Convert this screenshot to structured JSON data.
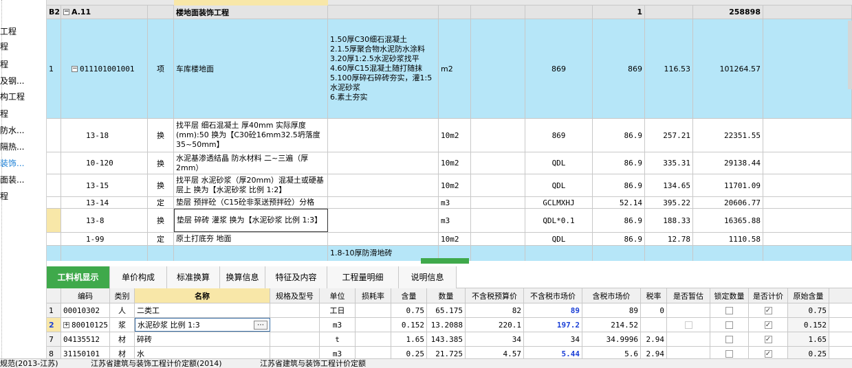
{
  "sidebar": {
    "items": [
      {
        "label": "工程"
      },
      {
        "label": "程"
      },
      {
        "label": "程"
      },
      {
        "label": "及钢..."
      },
      {
        "label": "构工程"
      },
      {
        "label": "程"
      },
      {
        "label": "防水..."
      },
      {
        "label": "隔热..."
      },
      {
        "label": "装饰..."
      },
      {
        "label": "面装..."
      },
      {
        "label": "程"
      }
    ],
    "selected_index": 8
  },
  "grid": {
    "section_row": {
      "num": "B2",
      "code": "A.11",
      "name": "楼地面装饰工程",
      "quantity": "1",
      "total": "258898"
    },
    "main_item": {
      "num": "1",
      "code": "011101001001",
      "type": "项",
      "name": "车库楼地面",
      "features": "1.50厚C30细石混凝土\n2.1.5厚聚合物水泥防水涂料\n3.20厚1:2.5水泥砂浆找平\n4.60厚C15混凝土随打随抹\n5.100厚碎石碎砖夯实，灌1:5水泥砂浆\n6.素土夯实",
      "unit": "m2",
      "qty_expr": "869",
      "quantity": "869",
      "unit_price": "116.53",
      "total": "101264.57"
    },
    "sub_items": [
      {
        "code": "13-18",
        "type": "换",
        "name": "找平层 细石混凝土 厚40mm  实际厚度(mm):50  换为【C30砼16mm32.5坍落度35~50mm】",
        "unit": "10m2",
        "qty_expr": "869",
        "quantity": "86.9",
        "unit_price": "257.21",
        "total": "22351.55"
      },
      {
        "code": "10-120",
        "type": "换",
        "name": "水泥基渗透结晶 防水材料 二~三遍（厚2mm）",
        "unit": "10m2",
        "qty_expr": "QDL",
        "quantity": "86.9",
        "unit_price": "335.31",
        "total": "29138.44"
      },
      {
        "code": "13-15",
        "type": "换",
        "name": "找平层 水泥砂浆（厚20mm）混凝土或硬基层上  换为【水泥砂浆 比例 1:2】",
        "unit": "10m2",
        "qty_expr": "QDL",
        "quantity": "86.9",
        "unit_price": "134.65",
        "total": "11701.09"
      },
      {
        "code": "13-14",
        "type": "定",
        "name": "垫层 预拌砼（C15砼非泵送预拌砼）分格",
        "unit": "m3",
        "qty_expr": "GCLMXHJ",
        "quantity": "52.14",
        "unit_price": "395.22",
        "total": "20606.77"
      },
      {
        "code": "13-8",
        "type": "换",
        "name": "垫层 碎砖 灌浆  换为【水泥砂浆 比例 1:3】",
        "unit": "m3",
        "qty_expr": "QDL*0.1",
        "quantity": "86.9",
        "unit_price": "188.33",
        "total": "16365.88"
      },
      {
        "code": "1-99",
        "type": "定",
        "name": "原土打底夯 地面",
        "unit": "10m2",
        "qty_expr": "QDL",
        "quantity": "86.9",
        "unit_price": "12.78",
        "total": "1110.58"
      }
    ],
    "partial_row_features": "1.8-10厚防滑地砖"
  },
  "tabs": [
    {
      "label": "工料机显示",
      "active": true
    },
    {
      "label": "单价构成"
    },
    {
      "label": "标准换算"
    },
    {
      "label": "换算信息"
    },
    {
      "label": "特征及内容"
    },
    {
      "label": "工程量明细"
    },
    {
      "label": "说明信息"
    }
  ],
  "bottom_grid": {
    "headers": [
      "编码",
      "类别",
      "名称",
      "规格及型号",
      "单位",
      "损耗率",
      "含量",
      "数量",
      "不含税预算价",
      "不含税市场价",
      "含税市场价",
      "税率",
      "是否暂估",
      "锁定数量",
      "是否计价",
      "原始含量"
    ],
    "rows": [
      {
        "idx": "1",
        "code": "00010302",
        "type": "人",
        "name": "二类工",
        "spec": "",
        "unit": "工日",
        "loss": "",
        "content": "0.75",
        "qty": "65.175",
        "budget": "82",
        "market": "89",
        "market_tax": "89",
        "tax": "0",
        "provisional": false,
        "lock": false,
        "priced": true,
        "orig": "0.75",
        "market_blue": true,
        "show_prov": false
      },
      {
        "idx": "2",
        "code": "80010125",
        "type": "浆",
        "name": "水泥砂浆 比例 1:3",
        "spec": "",
        "unit": "m3",
        "loss": "",
        "content": "0.152",
        "qty": "13.2088",
        "budget": "220.1",
        "market": "197.2",
        "market_tax": "214.52",
        "tax": "",
        "provisional": false,
        "lock": false,
        "priced": true,
        "orig": "0.152",
        "market_blue": true,
        "show_prov": true
      },
      {
        "idx": "7",
        "code": "04135512",
        "type": "材",
        "name": "碎砖",
        "spec": "",
        "unit": "t",
        "loss": "",
        "content": "1.65",
        "qty": "143.385",
        "budget": "34",
        "market": "34",
        "market_tax": "34.9996",
        "tax": "2.94",
        "provisional": false,
        "lock": false,
        "priced": true,
        "orig": "1.65",
        "market_blue": false,
        "show_prov": false
      },
      {
        "idx": "8",
        "code": "31150101",
        "type": "材",
        "name": "水",
        "spec": "",
        "unit": "m3",
        "loss": "",
        "content": "0.25",
        "qty": "21.725",
        "budget": "4.57",
        "market": "5.44",
        "market_tax": "5.6",
        "tax": "2.94",
        "provisional": false,
        "lock": false,
        "priced": true,
        "orig": "0.25",
        "market_blue": true,
        "show_prov": false
      }
    ]
  },
  "statusbar": {
    "items": [
      "规范(2013-江苏)",
      "江苏省建筑与装饰工程计价定额(2014)",
      "江苏省建筑与装饰工程计价定额"
    ]
  },
  "colors": {
    "highlight_row": "#b6e6f8",
    "active_tab": "#3fa94b",
    "name_header": "#f8e7a8"
  }
}
